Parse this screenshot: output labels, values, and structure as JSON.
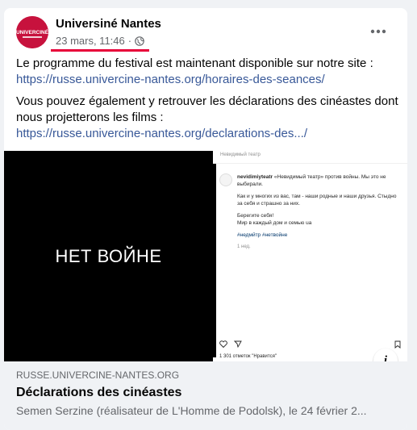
{
  "post": {
    "author": "Universiné Nantes",
    "date": "23 mars, 11:46",
    "separator": "·",
    "avatar_text": "UNIVERCINÉ",
    "audience_icon": "globe-icon",
    "more_icon": "more-horizontal-icon"
  },
  "content": {
    "line1": "Le programme du festival est maintenant disponible sur notre site :",
    "link1": "https://russe.univercine-nantes.org/horaires-des-seances/",
    "line2": "Vous pouvez également y retrouver les déclarations des cinéastes dont nous projetterons les films :",
    "link2": "https://russe.univercine-nantes.org/declarations-des.../"
  },
  "media": {
    "left_text": "НЕТ ВОЙНЕ",
    "insta_header": "Невидимый театр",
    "insta_username": "nevidimiyteatr",
    "insta_caption": "«Невидимый театр» против войны. Мы это не выбирали.",
    "insta_p2": "Как и у многих из вас, там - наши родные и наши друзья. Стыдно за себя и страшно за них.",
    "insta_p3a": "Берегите себя!",
    "insta_p3b": "Мир в каждый дом и семью ua",
    "insta_tags": "#нетвойне",
    "insta_tags2": "#недмйтр #нетвойне",
    "insta_ago": "1 нед.",
    "insta_likes": "1 301 отметок \"Нравится\"",
    "info_label": "i"
  },
  "link_preview": {
    "domain": "RUSSE.UNIVERCINE-NANTES.ORG",
    "title": "Déclarations des cinéastes",
    "description": "Semen Serzine (réalisateur de L'Homme de Podolsk), le 24 février 2..."
  },
  "colors": {
    "accent": "#e8003a",
    "link": "#385898",
    "brand": "#c7123d"
  }
}
